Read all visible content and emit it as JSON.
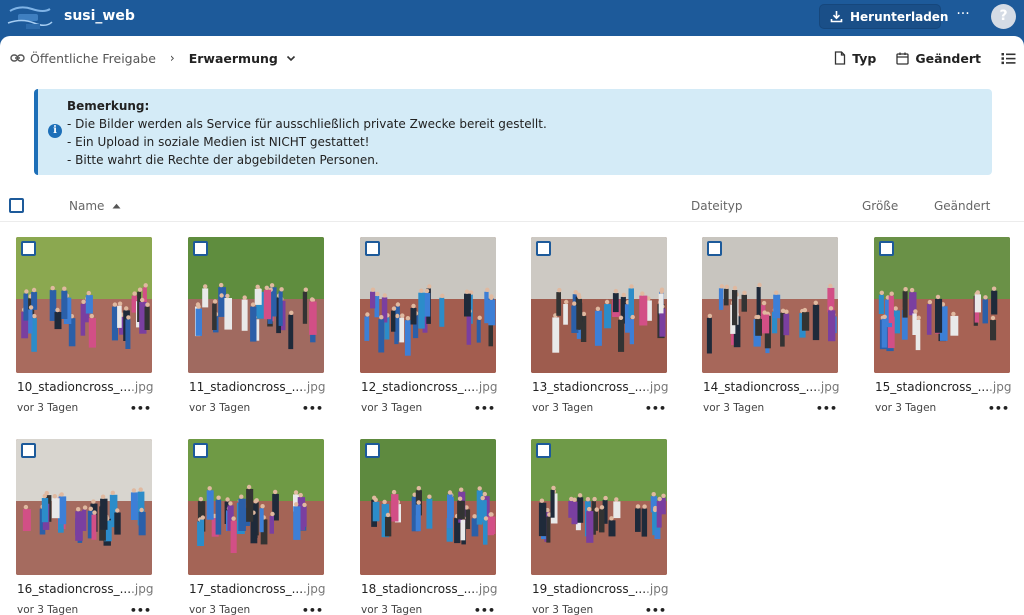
{
  "header": {
    "app_title": "susi_web",
    "download_label": "Herunterladen",
    "help_label": "?",
    "colors": {
      "brand": "#1d5a9a",
      "accent": "#1d6fb8"
    }
  },
  "breadcrumb": {
    "root_label": "Öffentliche Freigabe",
    "current_label": "Erwaermung"
  },
  "toolbar": {
    "type_label": "Typ",
    "modified_label": "Geändert"
  },
  "note": {
    "title": "Bemerkung:",
    "lines": [
      "- Die Bilder werden als Service für ausschließlich private Zwecke bereit gestellt.",
      "- Ein Upload in soziale Medien ist NICHT gestattet!",
      "- Bitte wahrt die Rechte der abgebildeten Personen."
    ]
  },
  "columns": {
    "name": "Name",
    "type": "Dateityp",
    "size": "Größe",
    "modified": "Geändert"
  },
  "files": [
    {
      "name": "10_stadioncross_...",
      "ext": ".jpg",
      "modified": "vor 3 Tagen",
      "sky": "#8ba850",
      "ground": "#a96b5e"
    },
    {
      "name": "11_stadioncross_...",
      "ext": ".jpg",
      "modified": "vor 3 Tagen",
      "sky": "#5f8d3e",
      "ground": "#a06a60"
    },
    {
      "name": "12_stadioncross_...",
      "ext": ".jpg",
      "modified": "vor 3 Tagen",
      "sky": "#c9c6c0",
      "ground": "#a35d4f"
    },
    {
      "name": "13_stadioncross_...",
      "ext": ".jpg",
      "modified": "vor 3 Tagen",
      "sky": "#cdc9c3",
      "ground": "#9e5c4e"
    },
    {
      "name": "14_stadioncross_...",
      "ext": ".jpg",
      "modified": "vor 3 Tagen",
      "sky": "#c8c5bf",
      "ground": "#a7675a"
    },
    {
      "name": "15_stadioncross_...",
      "ext": ".jpg",
      "modified": "vor 3 Tagen",
      "sky": "#6a9147",
      "ground": "#a76254"
    },
    {
      "name": "16_stadioncross_...",
      "ext": ".jpg",
      "modified": "vor 3 Tagen",
      "sky": "#d8d5cf",
      "ground": "#a56b5f"
    },
    {
      "name": "17_stadioncross_...",
      "ext": ".jpg",
      "modified": "vor 3 Tagen",
      "sky": "#6f9a45",
      "ground": "#a46456"
    },
    {
      "name": "18_stadioncross_...",
      "ext": ".jpg",
      "modified": "vor 3 Tagen",
      "sky": "#5e8a3f",
      "ground": "#a45f51"
    },
    {
      "name": "19_stadioncross_...",
      "ext": ".jpg",
      "modified": "vor 3 Tagen",
      "sky": "#6f9a48",
      "ground": "#a56456"
    }
  ]
}
